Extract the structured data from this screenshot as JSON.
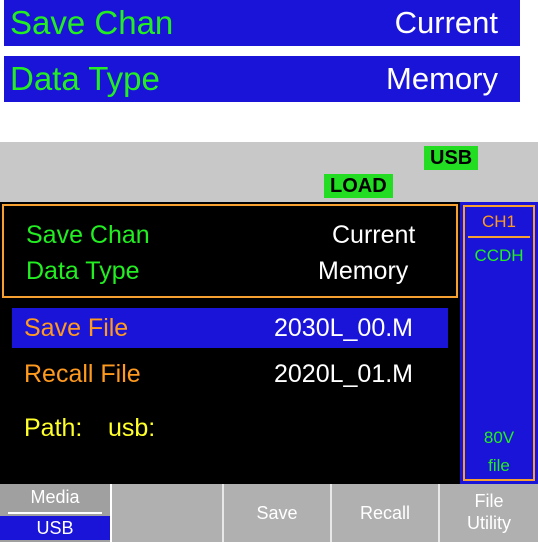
{
  "zoom": {
    "save_chan": {
      "label": "Save Chan",
      "value": "Current"
    },
    "data_type": {
      "label": "Data Type",
      "value": "Memory"
    }
  },
  "status": {
    "usb": "USB",
    "load": "LOAD"
  },
  "panel": {
    "save_chan_label": "Save Chan",
    "save_chan_value": "Current",
    "data_type_label": "Data Type",
    "data_type_value": "Memory",
    "save_file_label": "Save File",
    "save_file_value": "2030L_00.M",
    "recall_file_label": "Recall File",
    "recall_file_value": "2020L_01.M",
    "path_label": "Path:",
    "path_value": "usb:"
  },
  "side": {
    "channel": "CH1",
    "mode": "CCDH",
    "voltage": "80V",
    "file": "file"
  },
  "softkeys": {
    "media_label": "Media",
    "media_value": "USB",
    "save": "Save",
    "recall": "Recall",
    "file_utility_line1": "File",
    "file_utility_line2": "Utility"
  },
  "colors": {
    "accent_blue": "#1a14d9",
    "label_green": "#22ee22",
    "orange": "#ff9a1f",
    "yellow": "#ffff2a"
  }
}
